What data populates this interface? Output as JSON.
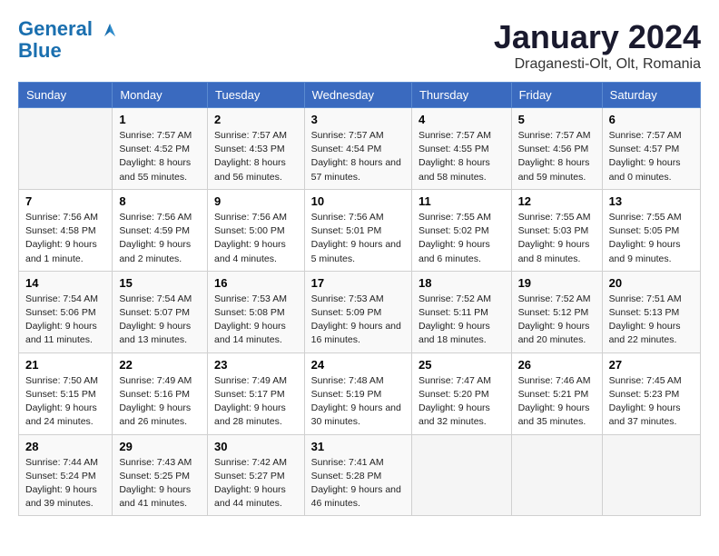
{
  "header": {
    "logo_line1": "General",
    "logo_line2": "Blue",
    "month": "January 2024",
    "location": "Draganesti-Olt, Olt, Romania"
  },
  "weekdays": [
    "Sunday",
    "Monday",
    "Tuesday",
    "Wednesday",
    "Thursday",
    "Friday",
    "Saturday"
  ],
  "weeks": [
    [
      {
        "day": "",
        "sunrise": "",
        "sunset": "",
        "daylight": ""
      },
      {
        "day": "1",
        "sunrise": "Sunrise: 7:57 AM",
        "sunset": "Sunset: 4:52 PM",
        "daylight": "Daylight: 8 hours and 55 minutes."
      },
      {
        "day": "2",
        "sunrise": "Sunrise: 7:57 AM",
        "sunset": "Sunset: 4:53 PM",
        "daylight": "Daylight: 8 hours and 56 minutes."
      },
      {
        "day": "3",
        "sunrise": "Sunrise: 7:57 AM",
        "sunset": "Sunset: 4:54 PM",
        "daylight": "Daylight: 8 hours and 57 minutes."
      },
      {
        "day": "4",
        "sunrise": "Sunrise: 7:57 AM",
        "sunset": "Sunset: 4:55 PM",
        "daylight": "Daylight: 8 hours and 58 minutes."
      },
      {
        "day": "5",
        "sunrise": "Sunrise: 7:57 AM",
        "sunset": "Sunset: 4:56 PM",
        "daylight": "Daylight: 8 hours and 59 minutes."
      },
      {
        "day": "6",
        "sunrise": "Sunrise: 7:57 AM",
        "sunset": "Sunset: 4:57 PM",
        "daylight": "Daylight: 9 hours and 0 minutes."
      }
    ],
    [
      {
        "day": "7",
        "sunrise": "Sunrise: 7:56 AM",
        "sunset": "Sunset: 4:58 PM",
        "daylight": "Daylight: 9 hours and 1 minute."
      },
      {
        "day": "8",
        "sunrise": "Sunrise: 7:56 AM",
        "sunset": "Sunset: 4:59 PM",
        "daylight": "Daylight: 9 hours and 2 minutes."
      },
      {
        "day": "9",
        "sunrise": "Sunrise: 7:56 AM",
        "sunset": "Sunset: 5:00 PM",
        "daylight": "Daylight: 9 hours and 4 minutes."
      },
      {
        "day": "10",
        "sunrise": "Sunrise: 7:56 AM",
        "sunset": "Sunset: 5:01 PM",
        "daylight": "Daylight: 9 hours and 5 minutes."
      },
      {
        "day": "11",
        "sunrise": "Sunrise: 7:55 AM",
        "sunset": "Sunset: 5:02 PM",
        "daylight": "Daylight: 9 hours and 6 minutes."
      },
      {
        "day": "12",
        "sunrise": "Sunrise: 7:55 AM",
        "sunset": "Sunset: 5:03 PM",
        "daylight": "Daylight: 9 hours and 8 minutes."
      },
      {
        "day": "13",
        "sunrise": "Sunrise: 7:55 AM",
        "sunset": "Sunset: 5:05 PM",
        "daylight": "Daylight: 9 hours and 9 minutes."
      }
    ],
    [
      {
        "day": "14",
        "sunrise": "Sunrise: 7:54 AM",
        "sunset": "Sunset: 5:06 PM",
        "daylight": "Daylight: 9 hours and 11 minutes."
      },
      {
        "day": "15",
        "sunrise": "Sunrise: 7:54 AM",
        "sunset": "Sunset: 5:07 PM",
        "daylight": "Daylight: 9 hours and 13 minutes."
      },
      {
        "day": "16",
        "sunrise": "Sunrise: 7:53 AM",
        "sunset": "Sunset: 5:08 PM",
        "daylight": "Daylight: 9 hours and 14 minutes."
      },
      {
        "day": "17",
        "sunrise": "Sunrise: 7:53 AM",
        "sunset": "Sunset: 5:09 PM",
        "daylight": "Daylight: 9 hours and 16 minutes."
      },
      {
        "day": "18",
        "sunrise": "Sunrise: 7:52 AM",
        "sunset": "Sunset: 5:11 PM",
        "daylight": "Daylight: 9 hours and 18 minutes."
      },
      {
        "day": "19",
        "sunrise": "Sunrise: 7:52 AM",
        "sunset": "Sunset: 5:12 PM",
        "daylight": "Daylight: 9 hours and 20 minutes."
      },
      {
        "day": "20",
        "sunrise": "Sunrise: 7:51 AM",
        "sunset": "Sunset: 5:13 PM",
        "daylight": "Daylight: 9 hours and 22 minutes."
      }
    ],
    [
      {
        "day": "21",
        "sunrise": "Sunrise: 7:50 AM",
        "sunset": "Sunset: 5:15 PM",
        "daylight": "Daylight: 9 hours and 24 minutes."
      },
      {
        "day": "22",
        "sunrise": "Sunrise: 7:49 AM",
        "sunset": "Sunset: 5:16 PM",
        "daylight": "Daylight: 9 hours and 26 minutes."
      },
      {
        "day": "23",
        "sunrise": "Sunrise: 7:49 AM",
        "sunset": "Sunset: 5:17 PM",
        "daylight": "Daylight: 9 hours and 28 minutes."
      },
      {
        "day": "24",
        "sunrise": "Sunrise: 7:48 AM",
        "sunset": "Sunset: 5:19 PM",
        "daylight": "Daylight: 9 hours and 30 minutes."
      },
      {
        "day": "25",
        "sunrise": "Sunrise: 7:47 AM",
        "sunset": "Sunset: 5:20 PM",
        "daylight": "Daylight: 9 hours and 32 minutes."
      },
      {
        "day": "26",
        "sunrise": "Sunrise: 7:46 AM",
        "sunset": "Sunset: 5:21 PM",
        "daylight": "Daylight: 9 hours and 35 minutes."
      },
      {
        "day": "27",
        "sunrise": "Sunrise: 7:45 AM",
        "sunset": "Sunset: 5:23 PM",
        "daylight": "Daylight: 9 hours and 37 minutes."
      }
    ],
    [
      {
        "day": "28",
        "sunrise": "Sunrise: 7:44 AM",
        "sunset": "Sunset: 5:24 PM",
        "daylight": "Daylight: 9 hours and 39 minutes."
      },
      {
        "day": "29",
        "sunrise": "Sunrise: 7:43 AM",
        "sunset": "Sunset: 5:25 PM",
        "daylight": "Daylight: 9 hours and 41 minutes."
      },
      {
        "day": "30",
        "sunrise": "Sunrise: 7:42 AM",
        "sunset": "Sunset: 5:27 PM",
        "daylight": "Daylight: 9 hours and 44 minutes."
      },
      {
        "day": "31",
        "sunrise": "Sunrise: 7:41 AM",
        "sunset": "Sunset: 5:28 PM",
        "daylight": "Daylight: 9 hours and 46 minutes."
      },
      {
        "day": "",
        "sunrise": "",
        "sunset": "",
        "daylight": ""
      },
      {
        "day": "",
        "sunrise": "",
        "sunset": "",
        "daylight": ""
      },
      {
        "day": "",
        "sunrise": "",
        "sunset": "",
        "daylight": ""
      }
    ]
  ]
}
